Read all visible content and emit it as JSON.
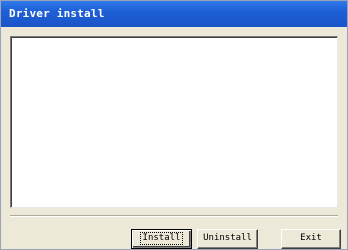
{
  "window": {
    "title": "Driver install"
  },
  "buttons": {
    "install_label": "Install",
    "uninstall_label": "Uninstall",
    "exit_label": "Exit"
  },
  "colors": {
    "titlebar": "#1e5fd6",
    "face": "#ece9d8",
    "log_background": "#ffffff"
  }
}
